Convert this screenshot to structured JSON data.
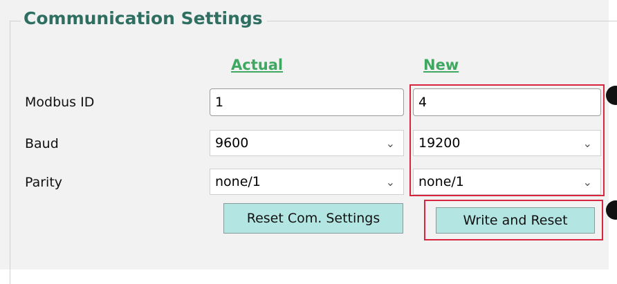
{
  "group": {
    "title": "Communication Settings"
  },
  "columns": {
    "actual": "Actual ",
    "new": "New"
  },
  "rows": {
    "modbus_id": {
      "label": "Modbus ID",
      "actual": "1",
      "new": "4"
    },
    "baud": {
      "label": "Baud",
      "actual": "9600",
      "new": "19200"
    },
    "parity": {
      "label": "Parity",
      "actual": "none/1",
      "new": "none/1"
    }
  },
  "buttons": {
    "reset": "Reset Com. Settings",
    "write": "Write and Reset"
  },
  "icons": {
    "dropdown": "chevron-down-icon",
    "marker": "step-marker"
  },
  "colors": {
    "accent_title": "#2f6f62",
    "header_green": "#3ea860",
    "button_bg": "#b3e6e3",
    "highlight_red": "#d8253d"
  }
}
